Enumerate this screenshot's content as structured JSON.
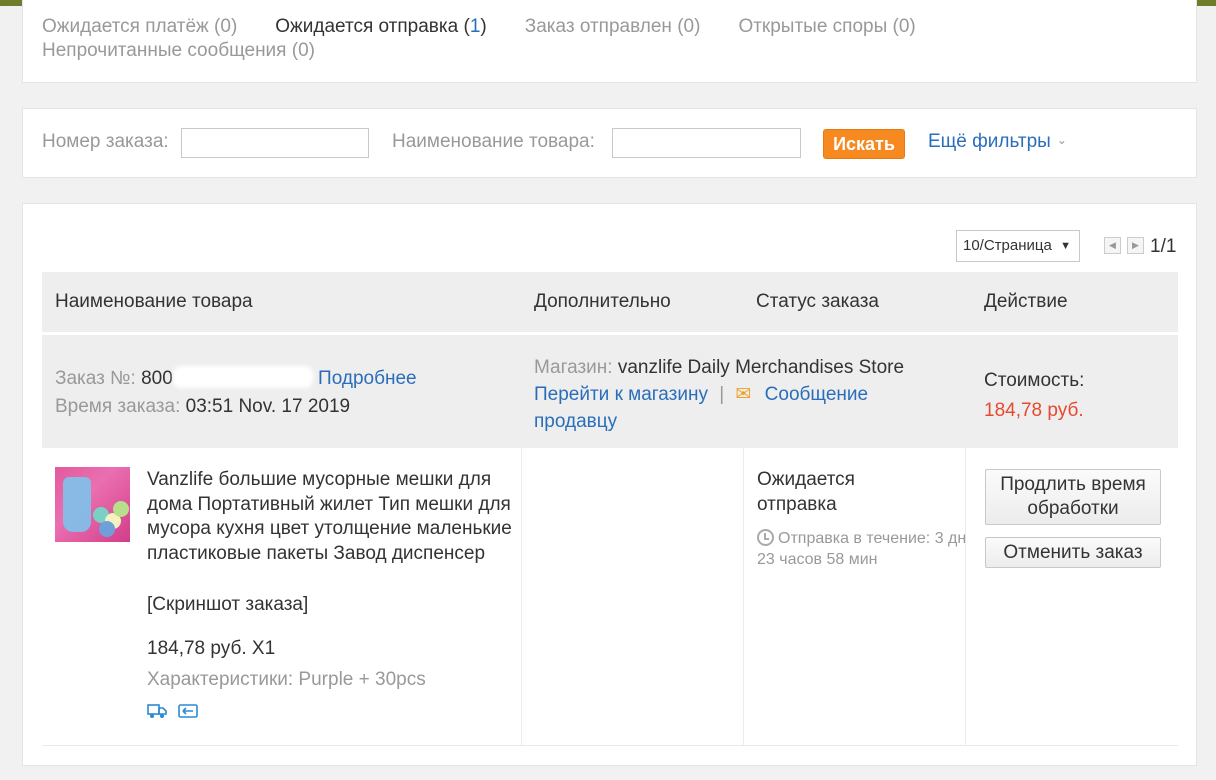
{
  "status_tabs": [
    {
      "label": "Ожидается платёж",
      "count": "(0)",
      "active": false
    },
    {
      "label": "Ожидается отправка",
      "count": "1",
      "active": true
    },
    {
      "label": "Заказ отправлен",
      "count": "(0)",
      "active": false
    },
    {
      "label": "Открытые споры",
      "count": "(0)",
      "active": false
    },
    {
      "label": "Непрочитанные сообщения",
      "count": "(0)",
      "active": false
    }
  ],
  "search": {
    "order_number_label": "Номер заказа:",
    "order_number_value": "",
    "product_name_label": "Наименование товара:",
    "product_name_value": "",
    "search_button": "Искать",
    "more_filters": "Ещё фильтры"
  },
  "pager": {
    "per_page": "10/Страница",
    "page_indicator": "1/1"
  },
  "table_headers": {
    "product": "Наименование товара",
    "additional": "Дополнительно",
    "status": "Статус заказа",
    "action": "Действие"
  },
  "order": {
    "number_label": "Заказ №:",
    "number_value": "800",
    "details_link": "Подробнее",
    "time_label": "Время заказа:",
    "time_value": "03:51 Nov. 17 2019",
    "store_label": "Магазин:",
    "store_name": "vanzlife Daily Merchandises Store",
    "go_to_store": "Перейти к магазину",
    "separator": "|",
    "message_seller": "Сообщение продавцу",
    "cost_label": "Стоимость:",
    "cost_value": "184,78 руб.",
    "item": {
      "title": "Vanzlife большие мусорные мешки для дома Портативный жилет Тип мешки для мусора кухня цвет утолщение маленькие пластиковые пакеты Завод диспенсер",
      "snapshot_link": "[Скриншот заказа]",
      "price_qty": "184,78 руб. X1",
      "specs": "Характеристики: Purple + 30pcs"
    },
    "status_text": "Ожидается отправка",
    "ship_within": "Отправка в течение: 3 дн 23 часов 58 мин",
    "extend_button": "Продлить время обработки",
    "cancel_button": "Отменить заказ"
  },
  "colors": {
    "link": "#2a6ebb",
    "accent_orange": "#f68a20",
    "price_red": "#e64a2e"
  }
}
